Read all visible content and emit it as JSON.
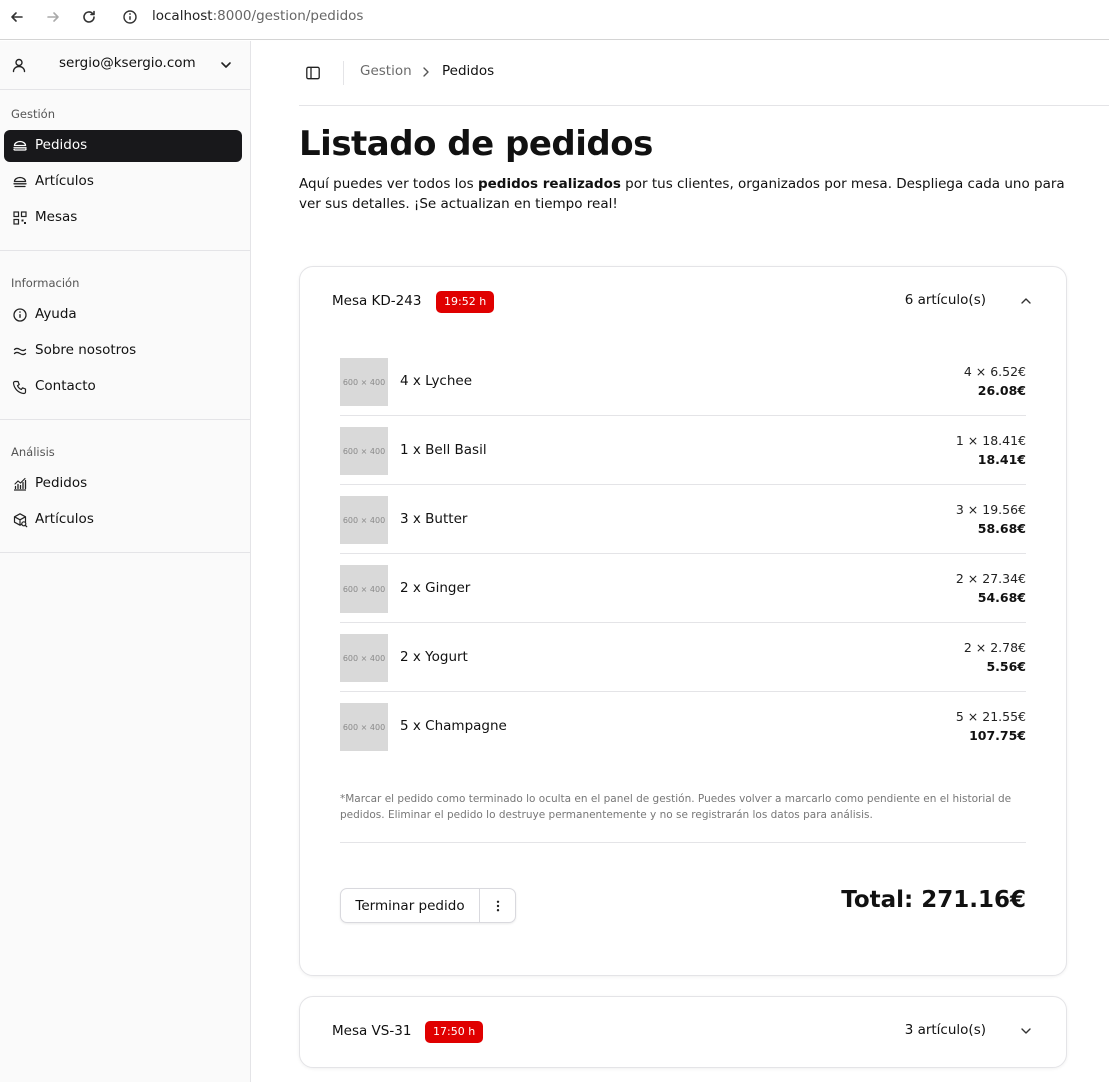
{
  "browser": {
    "url_host": "localhost",
    "url_path": ":8000/gestion/pedidos"
  },
  "sidebar": {
    "account_email": "sergio@ksergio.com",
    "sections": [
      {
        "title": "Gestión",
        "items": [
          {
            "label": "Pedidos",
            "icon": "burger-icon",
            "active": true
          },
          {
            "label": "Artículos",
            "icon": "burger-icon",
            "active": false
          },
          {
            "label": "Mesas",
            "icon": "qr-code-icon",
            "active": false
          }
        ]
      },
      {
        "title": "Información",
        "items": [
          {
            "label": "Ayuda",
            "icon": "info-icon",
            "active": false
          },
          {
            "label": "Sobre nosotros",
            "icon": "approx-icon",
            "active": false
          },
          {
            "label": "Contacto",
            "icon": "phone-icon",
            "active": false
          }
        ]
      },
      {
        "title": "Análisis",
        "items": [
          {
            "label": "Pedidos",
            "icon": "chart-icon",
            "active": false
          },
          {
            "label": "Artículos",
            "icon": "package-search-icon",
            "active": false
          }
        ]
      }
    ]
  },
  "breadcrumb": {
    "parent": "Gestion",
    "current": "Pedidos"
  },
  "main": {
    "title": "Listado de pedidos",
    "description_pre": "Aquí puedes ver todos los ",
    "description_bold": "pedidos realizados",
    "description_post": " por tus clientes, organizados por mesa. Despliega cada uno para ver sus detalles. ¡Se actualizan en tiempo real!"
  },
  "orders": [
    {
      "mesa": "Mesa KD-243",
      "time": "19:52 h",
      "count": "6 artículo(s)",
      "expanded": true,
      "items": [
        {
          "thumb": "600 × 400",
          "name": "4 x Lychee",
          "unit": "4 × 6.52€",
          "subtotal": "26.08€"
        },
        {
          "thumb": "600 × 400",
          "name": "1 x Bell Basil",
          "unit": "1 × 18.41€",
          "subtotal": "18.41€"
        },
        {
          "thumb": "600 × 400",
          "name": "3 x Butter",
          "unit": "3 × 19.56€",
          "subtotal": "58.68€"
        },
        {
          "thumb": "600 × 400",
          "name": "2 x Ginger",
          "unit": "2 × 27.34€",
          "subtotal": "54.68€"
        },
        {
          "thumb": "600 × 400",
          "name": "2 x Yogurt",
          "unit": "2 × 2.78€",
          "subtotal": "5.56€"
        },
        {
          "thumb": "600 × 400",
          "name": "5 x Champagne",
          "unit": "5 × 21.55€",
          "subtotal": "107.75€"
        }
      ],
      "note": "*Marcar el pedido como terminado lo oculta en el panel de gestión. Puedes volver a marcarlo como pendiente en el historial de pedidos. Eliminar el pedido lo destruye permanentemente y no se registrarán los datos para análisis.",
      "finish_label": "Terminar pedido",
      "total": "Total: 271.16€"
    },
    {
      "mesa": "Mesa VS-31",
      "time": "17:50 h",
      "count": "3 artículo(s)",
      "expanded": false
    }
  ],
  "colors": {
    "badge": "#e00000",
    "active_nav": "#18181b",
    "border": "#e4e4e7"
  }
}
